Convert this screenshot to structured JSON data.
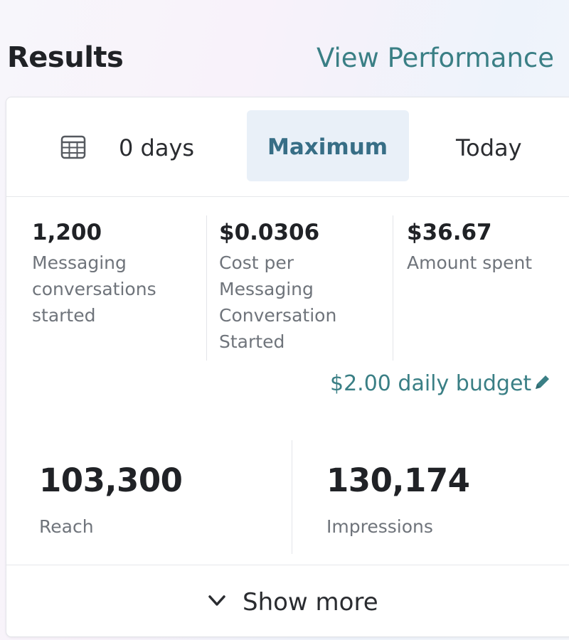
{
  "header": {
    "title": "Results",
    "view_link": "View Performance"
  },
  "date_range": {
    "icon": "calendar-icon",
    "options": [
      "0 days",
      "Maximum",
      "Today"
    ],
    "selected": "Maximum"
  },
  "metrics": [
    {
      "value": "1,200",
      "label": "Messaging conversations started"
    },
    {
      "value": "$0.0306",
      "label": "Cost per Messaging Conversation Started"
    },
    {
      "value": "$36.67",
      "label": "Amount spent"
    }
  ],
  "budget": {
    "text": "$2.00 daily budget",
    "icon": "pencil-icon"
  },
  "totals": [
    {
      "value": "103,300",
      "label": "Reach"
    },
    {
      "value": "130,174",
      "label": "Impressions"
    }
  ],
  "show_more": {
    "label": "Show more",
    "icon": "chevron-down-icon"
  },
  "colors": {
    "accent": "#3a7f85",
    "selected_bg": "#e9f0f8",
    "selected_text": "#376e86"
  }
}
